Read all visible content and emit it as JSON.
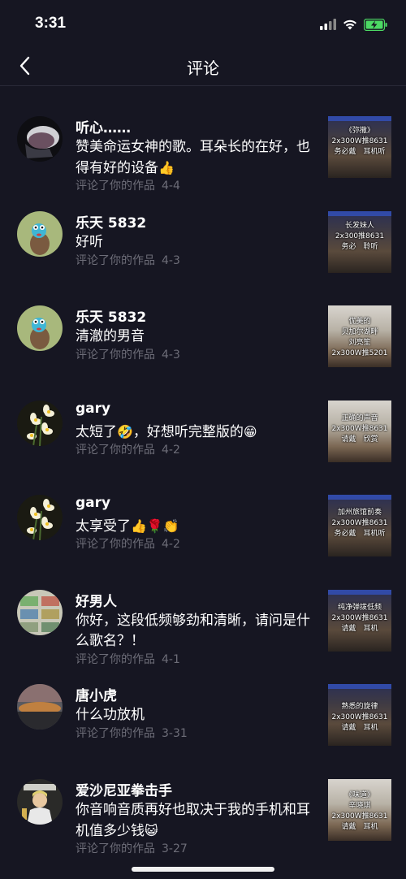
{
  "status": {
    "time": "3:31"
  },
  "nav": {
    "title": "评论"
  },
  "comments": [
    {
      "name": "听心……",
      "text": "赞美命运女神的歌。耳朵长的在好，也得有好的设备",
      "emoji": "👍",
      "action": "评论了你的作品",
      "date": "4-4",
      "thumb": [
        "《弥撒》",
        "2x300W推8631",
        "务必戴　耳机听"
      ]
    },
    {
      "name": "乐天 5832",
      "text": "好听",
      "emoji": "",
      "action": "评论了你的作品",
      "date": "4-3",
      "thumb": [
        "长发妹人",
        "2x300推8631",
        "务必　聆听"
      ]
    },
    {
      "name": "乐天 5832",
      "text": "清澈的男音",
      "emoji": "",
      "action": "评论了你的作品",
      "date": "4-3",
      "thumb": [
        "优美的",
        "贝加尔湖畔",
        "刘亮笙",
        "2x300W推5201"
      ]
    },
    {
      "name": "gary",
      "text": "太短了",
      "emoji": "🤣",
      "text2": "，好想听完整版的",
      "emoji2": "😁",
      "action": "评论了你的作品",
      "date": "4-2",
      "thumb": [
        "正确的声音",
        "2x300W推8631",
        "请戴　欣赏"
      ]
    },
    {
      "name": "gary",
      "text": "太享受了",
      "emoji": "👍🌹👏",
      "action": "评论了你的作品",
      "date": "4-2",
      "thumb": [
        "加州旅馆前奏",
        "2x300W推8631",
        "务必戴　耳机听"
      ]
    },
    {
      "name": "好男人",
      "text": "你好，这段低频够劲和清晰，请问是什么歌名？！",
      "emoji": "",
      "action": "评论了你的作品",
      "date": "4-1",
      "thumb": [
        "纯净弹拨低频",
        "2x300W推8631",
        "请戴　耳机"
      ]
    },
    {
      "name": "唐小虎",
      "text": "什么功放机",
      "emoji": "",
      "action": "评论了你的作品",
      "date": "3-31",
      "thumb": [
        "熟悉的旋律",
        "2x300W推8631",
        "请戴　耳机"
      ]
    },
    {
      "name": "爱沙尼亚拳击手",
      "text": "你音响音质再好也取决于我的手机和耳机值多少钱",
      "emoji": "😺",
      "action": "评论了你的作品",
      "date": "3-27",
      "thumb": [
        "《味道》",
        "辛晓琪",
        "2x300W推8631",
        "请戴　耳机"
      ]
    }
  ],
  "colors": {
    "background": "#161622",
    "meta": "#6d6d78",
    "battery": "#4cd964"
  },
  "icons": {
    "back": "chevron-left-icon",
    "signal": "signal-icon",
    "wifi": "wifi-icon",
    "battery": "battery-charging-icon"
  }
}
